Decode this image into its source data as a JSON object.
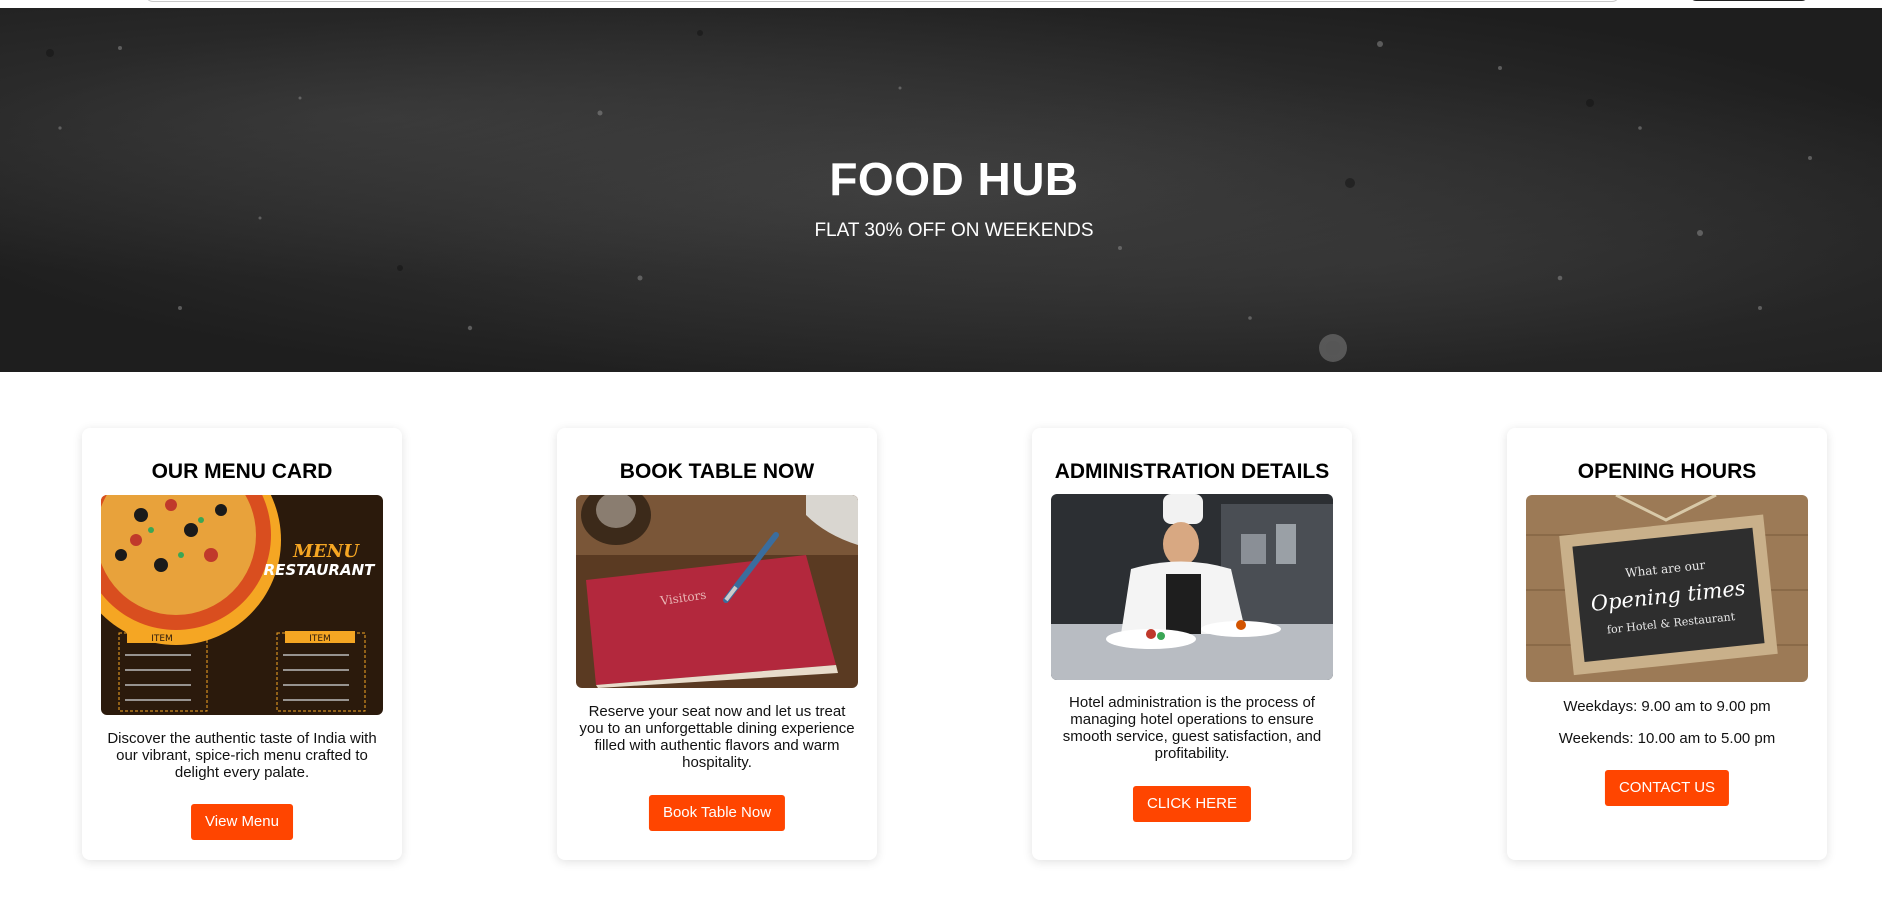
{
  "hero": {
    "title": "FOOD HUB",
    "subtitle": "FLAT 30% OFF ON WEEKENDS"
  },
  "cards": [
    {
      "title": "OUR MENU CARD",
      "image": "restaurant-menu-pizza-image",
      "image_text": {
        "menu": "MENU",
        "restaurant": "RESTAURANT",
        "item": "ITEM"
      },
      "description": "Discover the authentic taste of India with our vibrant, spice-rich menu crafted to delight every palate.",
      "button": "View Menu"
    },
    {
      "title": "BOOK TABLE NOW",
      "image": "visitors-book-image",
      "image_text": {
        "book": "Visitors"
      },
      "description": "Reserve your seat now and let us treat you to an unforgettable dining experience filled with authentic flavors and warm hospitality.",
      "button": "Book Table Now"
    },
    {
      "title": "ADMINISTRATION DETAILS",
      "image": "chef-plating-image",
      "description": "Hotel administration is the process of managing hotel operations to ensure smooth service, guest satisfaction, and profitability.",
      "button": "CLICK HERE"
    },
    {
      "title": "OPENING HOURS",
      "image": "opening-times-chalkboard-image",
      "image_text": {
        "line1": "What are our",
        "line2": "Opening times",
        "line3": "for Hotel & Restaurant"
      },
      "weekdays": "Weekdays: 9.00 am to 9.00 pm",
      "weekends": "Weekends: 10.00 am to 5.00 pm",
      "button": "CONTACT US"
    }
  ],
  "colors": {
    "accent": "#ff4500",
    "hero_bg": "#2a2a2a",
    "card_bg": "#ffffff"
  }
}
